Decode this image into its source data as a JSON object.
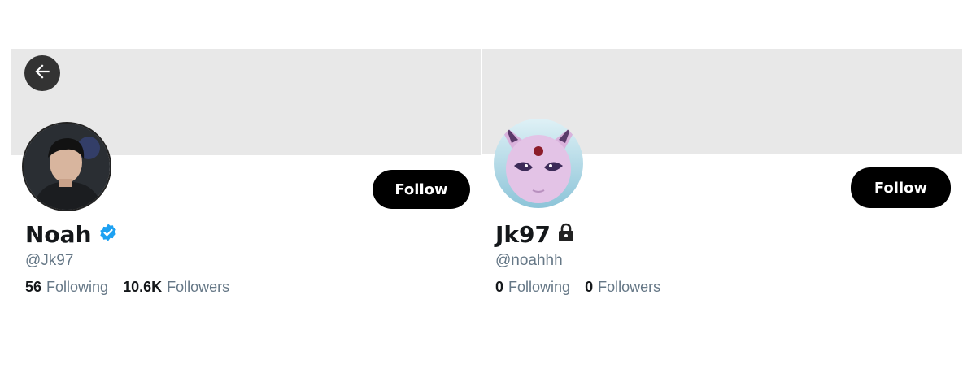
{
  "left_profile": {
    "name": "Noah",
    "handle": "@Jk97",
    "verified": true,
    "following_count": "56",
    "following_label": "Following",
    "followers_count": "10.6K",
    "followers_label": "Followers",
    "follow_label": "Follow",
    "back_icon": "arrow-left-icon",
    "badge_icon": "verified-badge-icon",
    "badge_color": "#1da1f2"
  },
  "right_profile": {
    "name": "Jk97",
    "handle": "@noahhh",
    "protected": true,
    "following_count": "0",
    "following_label": "Following",
    "followers_count": "0",
    "followers_label": "Followers",
    "follow_label": "Follow",
    "lock_icon": "lock-icon"
  },
  "colors": {
    "banner": "#e8e8e8",
    "button_bg": "#000000",
    "button_text": "#ffffff",
    "secondary_text": "#657786",
    "primary_text": "#14171a"
  }
}
